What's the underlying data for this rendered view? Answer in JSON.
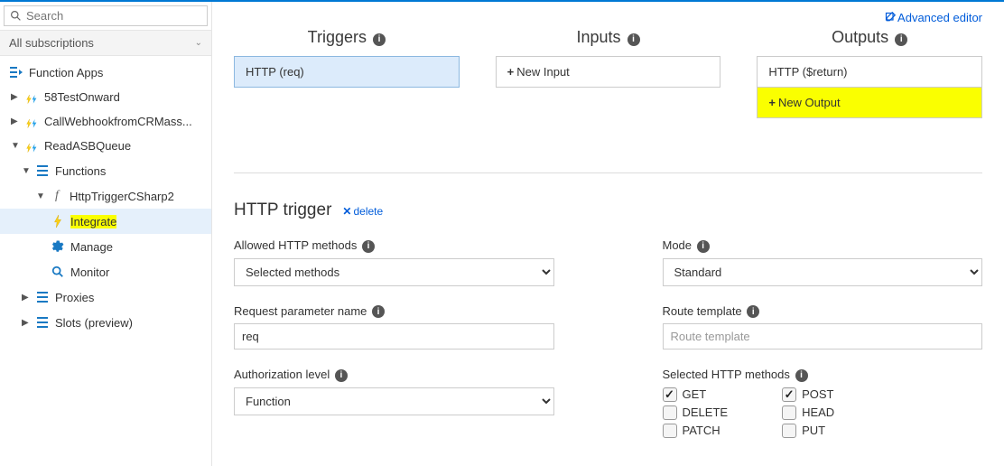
{
  "search": {
    "placeholder": "Search"
  },
  "subscriptions_label": "All subscriptions",
  "tree": {
    "function_apps": "Function Apps",
    "items": [
      {
        "label": "58TestOnward"
      },
      {
        "label": "CallWebhookfromCRMass..."
      },
      {
        "label": "ReadASBQueue"
      }
    ],
    "functions_label": "Functions",
    "fn_name": "HttpTriggerCSharp2",
    "integrate": "Integrate",
    "manage": "Manage",
    "monitor": "Monitor",
    "proxies": "Proxies",
    "slots": "Slots (preview)"
  },
  "advanced_editor": "Advanced editor",
  "headers": {
    "triggers": "Triggers",
    "inputs": "Inputs",
    "outputs": "Outputs"
  },
  "triggers_box": "HTTP (req)",
  "new_input": "New Input",
  "output_box": "HTTP ($return)",
  "new_output": "New Output",
  "http_trigger_title": "HTTP trigger",
  "delete_label": "delete",
  "form": {
    "allowed_methods_label": "Allowed HTTP methods",
    "allowed_methods_value": "Selected methods",
    "mode_label": "Mode",
    "mode_value": "Standard",
    "req_param_label": "Request parameter name",
    "req_param_value": "req",
    "route_label": "Route template",
    "route_placeholder": "Route template",
    "auth_label": "Authorization level",
    "auth_value": "Function",
    "selected_methods_label": "Selected HTTP methods",
    "methods": {
      "get": "GET",
      "delete": "DELETE",
      "patch": "PATCH",
      "post": "POST",
      "head": "HEAD",
      "put": "PUT"
    }
  }
}
